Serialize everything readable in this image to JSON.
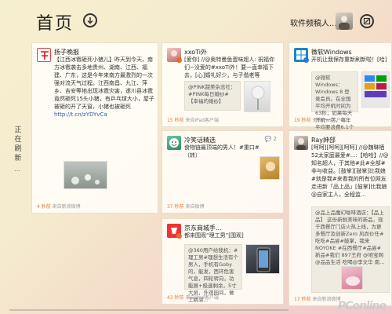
{
  "header": {
    "title": "首页",
    "user_name": "软件频稿人..."
  },
  "refresh": {
    "label": "正在刷新",
    "dots": "⋯"
  },
  "cards": {
    "c1": {
      "name": "扬子晚报",
      "text": "【江西冰雹砸死小猪儿】昨天到今天，南方冰雹袭击多地贵州、湖南、江西、福建、广东，这是今年来南方最激烈的一次强对流天气过程。江西南昌、九江、萍乡、吉安等地出现冰雹灾害，遂川县冰雹竟然砸死15头小猪，有乒乓球大小，屋子被砸的开了天窗，小猪也被砸死",
      "link": "http://t.cn/zYDYvCa",
      "footer_count": "4 秒前",
      "footer_src": "来自新浪微博"
    },
    "c2": {
      "name": "xxoTi外",
      "text": "[爱你] //@奥特曼鱼蛋味超人: 祝福你们~没爱的#xxoTi外！要一直幸福下去，[心]婚礼好少，与子偕老等",
      "quote": "@PINK甜美杂志社：#PINK每日婚纱#【幸福的婚纱】",
      "footer_count": "15 秒前",
      "footer_src": "来自iPad客户端"
    },
    "c3": {
      "name": "微软Windows",
      "text": "开机让我保存重新刷新啦！[哈]",
      "quote": "@微软Windows：Windows 8 登录会员。在全国平均开机时间为63秒，如果每天开机一次，每年平均要浪费6.1个小时。Win",
      "footer_count": "19 秒前",
      "footer_src": "来自iPad客户端"
    },
    "c4": {
      "name": "冷笑话精选",
      "text": "食物链最顶端的男人！#重口#（转）",
      "comments": "2",
      "footer_count": "37 秒前",
      "footer_src": "来自微博"
    },
    "c5": {
      "name": "Ray绅部",
      "text": "[呵呵][呵呵][呵呵] //@魏琳栖52太家庭最爱#...:【哈哈】//@知名超人，于其他#此#全部#非与收益。[鼓掌][鼓掌]比我娘#就是我#来看我的所有位网友走进新「品上品」[鼓掌]比我娘@自家主人，全程监...",
      "quote": "@品上品魔幻咖啡酒店：【品上品】 这份新鲜美味的新品，现于西餐厅门店火热上线，为更多餐厅及创新Zero 风尚价任#吃吃#品尝#鼓掌，我来NOYOKE #在西餐厅#品尝#新品#我们 897王府 @地宝网 @品品生活 吃喝@李文华 南...",
      "footer_count": "17 秒前",
      "footer_src": "来自新浪微博"
    },
    "c6": {
      "name": "京东商城手...",
      "text": "都来围观“理工男”[围观]",
      "quote": "@360用户给我机：#理工男#理想生活有个男人，手机有Goby的，能发，西环危害气息，四轮转向，功能展+极速剩余，5寸大屏，外观园间，做工精湛...",
      "footer_count": "43 秒前",
      "footer_src": "来自iPad客户端"
    }
  },
  "watermark": "PConline",
  "colors": {
    "accent": "#e07a3c",
    "link": "#2a5db0",
    "verified": "#e56a2c"
  }
}
